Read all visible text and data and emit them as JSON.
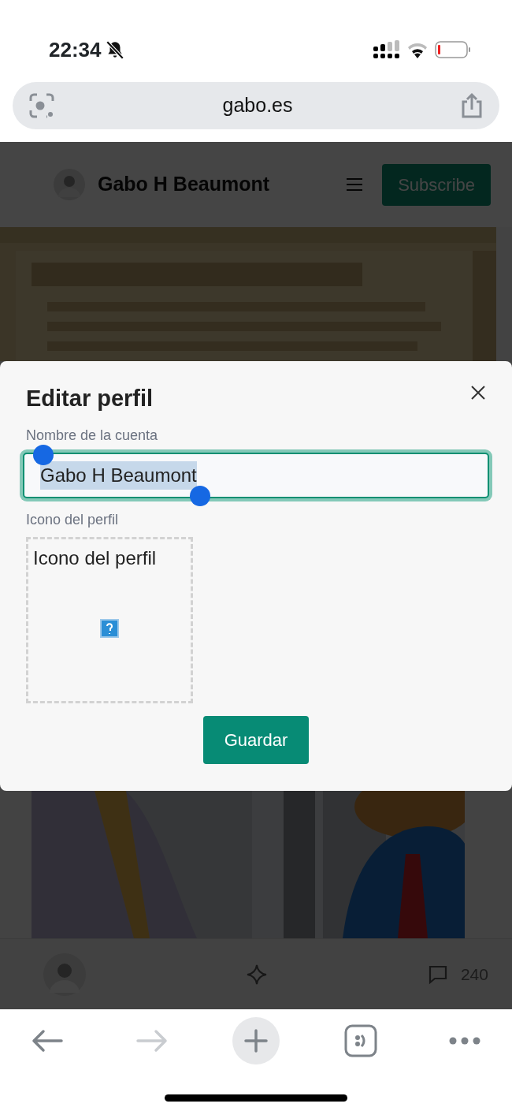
{
  "status_bar": {
    "time": "22:34"
  },
  "address_bar": {
    "url": "gabo.es"
  },
  "site_header": {
    "title": "Gabo H Beaumont",
    "subscribe": "Subscribe"
  },
  "post": {
    "comments": "240"
  },
  "modal": {
    "title": "Editar perfil",
    "name_label": "Nombre de la cuenta",
    "name_value": "Gabo H Beaumont",
    "text_selected": true,
    "icon_label": "Icono del perfil",
    "icon_alt": "Icono del perfil",
    "save": "Guardar"
  },
  "toolbar": [
    {
      "kind": "back",
      "disabled": false
    },
    {
      "kind": "forward",
      "disabled": true
    },
    {
      "kind": "new-tab",
      "disabled": false
    },
    {
      "kind": "tabs",
      "disabled": false
    },
    {
      "kind": "more",
      "disabled": false
    }
  ]
}
